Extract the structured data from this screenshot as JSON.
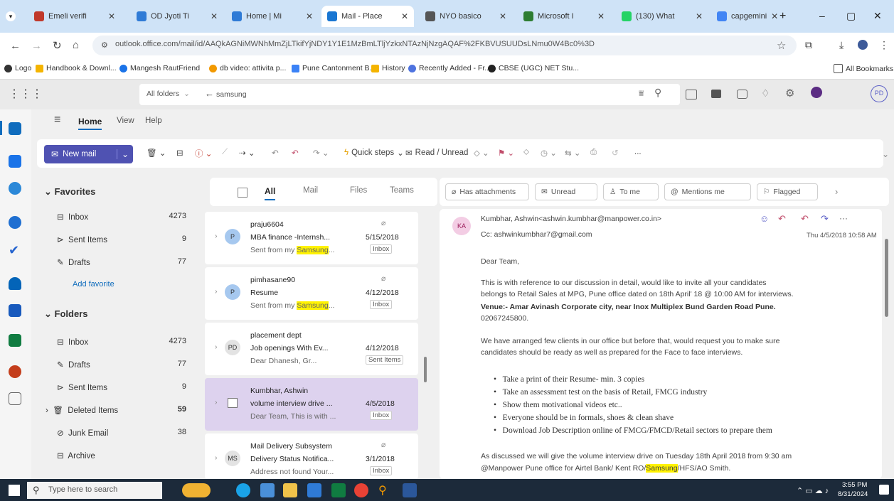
{
  "browser": {
    "tabs": [
      {
        "label": "Emeli verifi",
        "color": "#c0392b"
      },
      {
        "label": "OD Jyoti Ti",
        "color": "#2f7bd6"
      },
      {
        "label": "Home | Mi",
        "color": "#2f7bd6"
      },
      {
        "label": "Mail - Place",
        "color": "#1976d2",
        "active": true
      },
      {
        "label": "NYO basico",
        "color": "#555555"
      },
      {
        "label": "Microsoft I",
        "color": "#2e7d32"
      },
      {
        "label": "(130) What",
        "color": "#25d366"
      },
      {
        "label": "capgemini",
        "color": "#4285f4"
      }
    ],
    "window_controls": [
      "–",
      "▢",
      "✕"
    ],
    "url": "outlook.office.com/mail/id/AAQkAGNiMWNhMmZjLTkifYjNDY1Y1E1MzBmLTljYzkxNTAzNjNzgAQAF%2FKBVUSUUDsLNmu0W4Bc0%3D",
    "bookmarks": [
      "Logo",
      "Handbook & Downl...",
      "Mangesh RautFriend",
      "db video: attivita p...",
      "Pune Cantonment B...",
      "History",
      "Recently Added - Fr...",
      "CBSE (UGC) NET Stu..."
    ],
    "all_bookmarks": "All Bookmarks"
  },
  "outlook": {
    "search_scope": "All folders",
    "search_query": "samsung",
    "avatar_initials": "PD",
    "ribbon_tabs": [
      "Home",
      "View",
      "Help"
    ],
    "new_mail": "New mail",
    "quick_steps": "Quick steps",
    "read_unread": "Read / Unread",
    "more": "..."
  },
  "folders": {
    "favorites_header": "Favorites",
    "favorites": [
      {
        "label": "Inbox",
        "count": "4273"
      },
      {
        "label": "Sent Items",
        "count": "9"
      },
      {
        "label": "Drafts",
        "count": "77"
      }
    ],
    "add_favorite": "Add favorite",
    "folders_header": "Folders",
    "items": [
      {
        "label": "Inbox",
        "count": "4273"
      },
      {
        "label": "Drafts",
        "count": "77"
      },
      {
        "label": "Sent Items",
        "count": "9"
      },
      {
        "label": "Deleted Items",
        "count": "59"
      },
      {
        "label": "Junk Email",
        "count": "38"
      },
      {
        "label": "Archive",
        "count": ""
      }
    ]
  },
  "list": {
    "filters": [
      "All",
      "Mail",
      "Files",
      "Teams"
    ],
    "messages": [
      {
        "initial": "P",
        "from": "praju6604",
        "subject": "MBA finance -Internsh...",
        "date": "5/15/2018",
        "preview_pre": "Sent from my ",
        "highlight": "Samsung",
        "preview_post": "...",
        "folder": "Inbox",
        "avatar_color": "#a6c8ef"
      },
      {
        "initial": "P",
        "from": "pimhasane90",
        "subject": "Resume",
        "date": "4/12/2018",
        "preview_pre": "Sent from my ",
        "highlight": "Samsung",
        "preview_post": "...",
        "folder": "Inbox",
        "avatar_color": "#a6c8ef"
      },
      {
        "initial": "PD",
        "from": "placement dept",
        "subject": "Job openings With Ev...",
        "date": "4/12/2018",
        "preview_pre": "Dear Dhanesh, Gr...",
        "highlight": "",
        "preview_post": "",
        "folder": "Sent Items",
        "avatar_color": "#e3e3e3"
      },
      {
        "initial": "",
        "from": "Kumbhar, Ashwin",
        "subject": "volume interview drive ...",
        "date": "4/5/2018",
        "preview_pre": "Dear Team, This is with ...",
        "highlight": "",
        "preview_post": "",
        "folder": "Inbox",
        "avatar_color": "#ddd2ee"
      },
      {
        "initial": "MS",
        "from": "Mail Delivery Subsystem",
        "subject": "Delivery Status Notifica...",
        "date": "3/1/2018",
        "preview_pre": "Address not found Your...",
        "highlight": "",
        "preview_post": "",
        "folder": "Inbox",
        "avatar_color": "#e3e3e3"
      }
    ]
  },
  "reading": {
    "filters": [
      "Has attachments",
      "Unread",
      "To me",
      "Mentions me",
      "Flagged"
    ],
    "sender_initials": "KA",
    "sender": "Kumbhar, Ashwin<ashwin.kumbhar@manpower.co.in>",
    "cc": "Cc: ashwinkumbhar7@gmail.com",
    "datetime": "Thu 4/5/2018 10:58 AM",
    "greeting": "Dear Team,",
    "para1a": "This is with reference to our discussion in detail, would like to invite all your candidates",
    "para1b": "belongs to Retail Sales at MPG, Pune office dated on 18th April' 18 @ 10:00 AM for interviews.",
    "venue": "Venue:- Amar Avinash Corporate city, near Inox Multiplex Bund Garden Road Pune.",
    "phone": "02067245800.",
    "para2a": "We have arranged few clients in our office but before that, would request you to make sure",
    "para2b": "candidates should be ready as well as prepared for the Face to face interviews.",
    "bullets": [
      "Take a print of their Resume- min. 3 copies",
      "Take an assessment test on the basis of Retail, FMCG industry",
      "Show them motivational videos etc..",
      "Everyone should be in formals, shoes & clean shave",
      "Download Job Description online of FMCG/FMCD/Retail sectors to prepare them"
    ],
    "para3a": "As discussed we will give the volume interview drive on Tuesday 18th April 2018 from 9:30 am",
    "para3b_pre": "@Manpower Pune office for Airtel Bank/ Kent RO/",
    "para3b_hl": "Samsung",
    "para3b_post": "/HFS/AO Smith."
  },
  "taskbar": {
    "search_placeholder": "Type here to search",
    "time": "3:55 PM",
    "date": "8/31/2024"
  }
}
